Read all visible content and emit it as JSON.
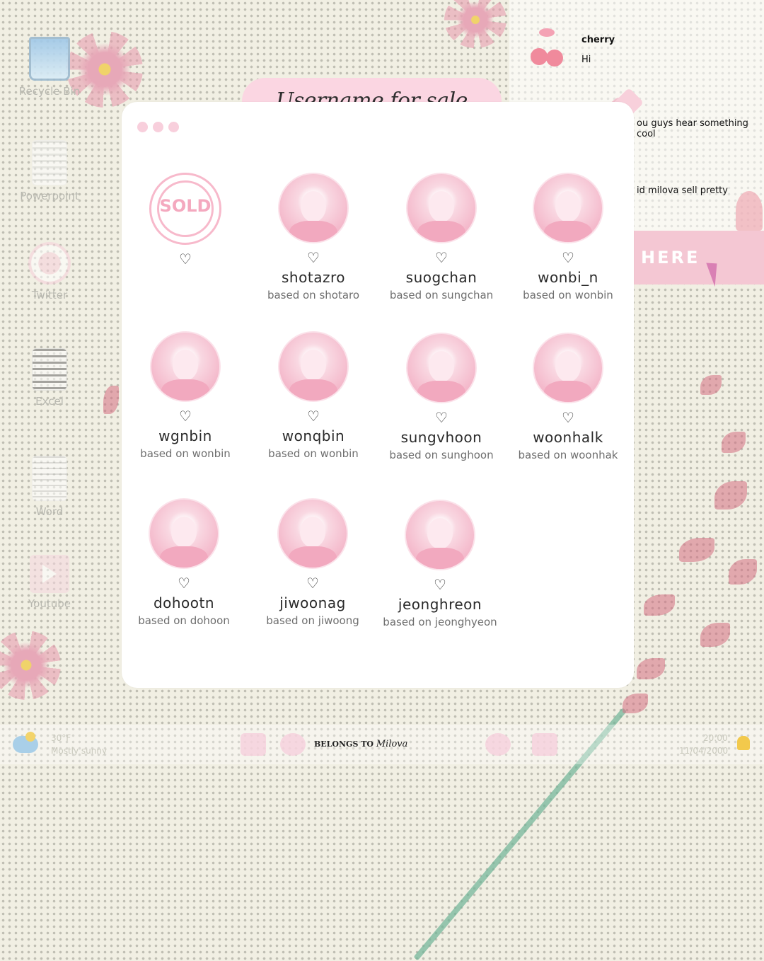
{
  "colors": {
    "accent_pink": "#fbd6e2",
    "avatar_pink": "#f4b9cb",
    "window_bg": "#ffffff"
  },
  "desktop": {
    "icons": [
      {
        "label": "Recycle Bin",
        "icon": "recycle-bin-icon"
      },
      {
        "label": "Powerpoint",
        "icon": "powerpoint-icon"
      },
      {
        "label": "Twitter",
        "icon": "twitter-icon"
      },
      {
        "label": "Excel",
        "icon": "excel-icon"
      },
      {
        "label": "Word",
        "icon": "word-icon"
      },
      {
        "label": "Youtube",
        "icon": "youtube-icon"
      }
    ]
  },
  "chat": {
    "name": "cherry",
    "messages": [
      "Hi",
      "ou guys hear something cool",
      "id milova sell pretty"
    ]
  },
  "banner": {
    "text": "HERE"
  },
  "window": {
    "title": "Username for sale",
    "cards": [
      {
        "status": "SOLD",
        "username": "",
        "based_on": ""
      },
      {
        "username": "shotazro",
        "based_on": "based on shotaro"
      },
      {
        "username": "suogchan",
        "based_on": "based on sungchan"
      },
      {
        "username": "wonbi_n",
        "based_on": "based on wonbin"
      },
      {
        "username": "wgnbin",
        "based_on": "based on wonbin"
      },
      {
        "username": "wonqbin",
        "based_on": "based on wonbin"
      },
      {
        "username": "sungvhoon",
        "based_on": "based on sunghoon"
      },
      {
        "username": "woonhalk",
        "based_on": "based on woonhak"
      },
      {
        "username": "dohootn",
        "based_on": "based on dohoon"
      },
      {
        "username": "jiwoonag",
        "based_on": "based on jiwoong"
      },
      {
        "username": "jeonghreon",
        "based_on": "based on jeonghyeon"
      }
    ]
  },
  "taskbar": {
    "temp": "30°F",
    "weather": "Mostly sunny",
    "brand_prefix": "BELONGS TO",
    "brand_name": "Milova",
    "time": "20:00",
    "date": "11/04/2000"
  }
}
